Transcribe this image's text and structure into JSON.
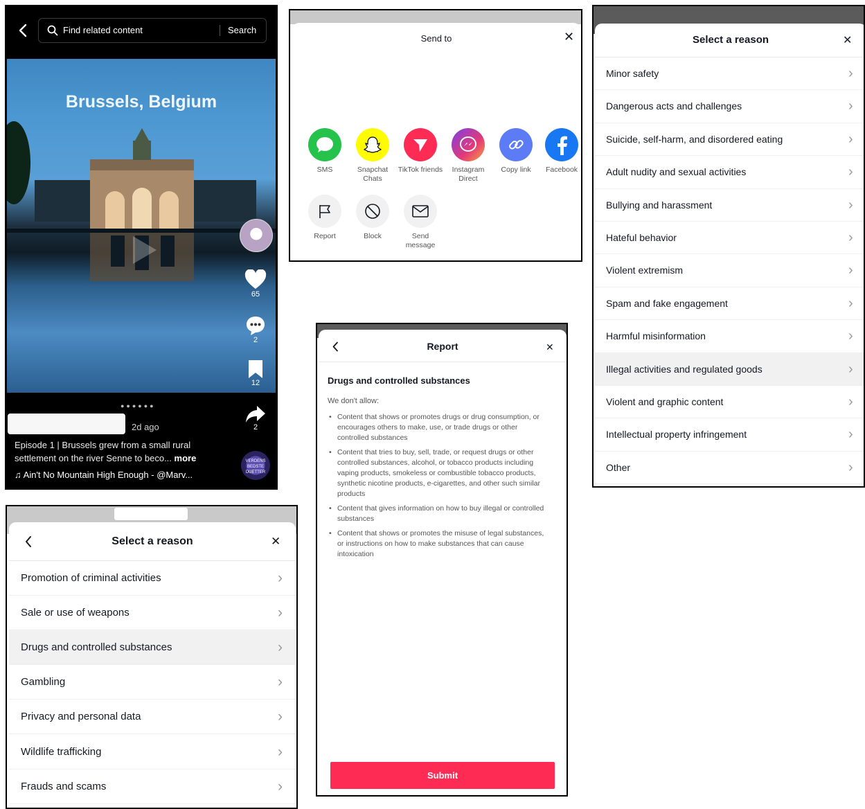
{
  "video": {
    "search_placeholder": "Find related content",
    "search_button": "Search",
    "overlay_title": "Brussels, Belgium",
    "likes": "65",
    "comments": "2",
    "saves": "12",
    "shares": "2",
    "time_ago": "2d ago",
    "caption_line1": "Episode 1 | Brussels grew from a small rural",
    "caption_line2": "settlement on the river Senne to beco...",
    "caption_more": "more",
    "music": "Ain't No Mountain High Enough - @Marv...",
    "disc_text": "VERDENS BEDSTE DUETTER"
  },
  "send": {
    "title": "Send to",
    "share_items": [
      {
        "label": "SMS",
        "icon": "sms-icon",
        "color": "#25c34b"
      },
      {
        "label": "Snapchat Chats",
        "icon": "snapchat-icon",
        "color": "#fffc00"
      },
      {
        "label": "TikTok friends",
        "icon": "tiktok-send-icon",
        "color": "#fe2c55"
      },
      {
        "label": "Instagram Direct",
        "icon": "messenger-icon",
        "color": "#c13584"
      },
      {
        "label": "Copy link",
        "icon": "link-icon",
        "color": "#5b7cf5"
      },
      {
        "label": "Facebook",
        "icon": "facebook-icon",
        "color": "#1877f2"
      }
    ],
    "action_items": [
      {
        "label": "Report",
        "icon": "flag-icon"
      },
      {
        "label": "Block",
        "icon": "block-icon"
      },
      {
        "label": "Send message",
        "icon": "envelope-icon"
      }
    ]
  },
  "reasons_main": {
    "title": "Select a reason",
    "items": [
      "Minor safety",
      "Dangerous acts and challenges",
      "Suicide, self-harm, and disordered eating",
      "Adult nudity and sexual activities",
      "Bullying and harassment",
      "Hateful behavior",
      "Violent extremism",
      "Spam and fake engagement",
      "Harmful misinformation",
      "Illegal activities and regulated goods",
      "Violent and graphic content",
      "Intellectual property infringement",
      "Other"
    ],
    "highlighted_index": 9
  },
  "reasons_sub": {
    "title": "Select a reason",
    "items": [
      "Promotion of criminal activities",
      "Sale or use of weapons",
      "Drugs and controlled substances",
      "Gambling",
      "Privacy and personal data",
      "Wildlife trafficking",
      "Frauds and scams"
    ],
    "highlighted_index": 2
  },
  "report": {
    "title": "Report",
    "heading": "Drugs and controlled substances",
    "intro": "We don't allow:",
    "bullets": [
      "Content that shows or promotes drugs or drug consumption, or encourages others to make, use, or trade drugs or other controlled substances",
      "Content that tries to buy, sell, trade, or request drugs or other controlled substances, alcohol, or tobacco products including vaping products, smokeless or combustible tobacco products, synthetic nicotine products, e-cigarettes, and other such similar products",
      "Content that gives information on how to buy illegal or controlled substances",
      "Content that shows or promotes the misuse of legal substances, or instructions on how to make substances that can cause intoxication"
    ],
    "submit": "Submit"
  },
  "colors": {
    "accent": "#fe2c55",
    "highlight_row": "#f1f1f2"
  }
}
